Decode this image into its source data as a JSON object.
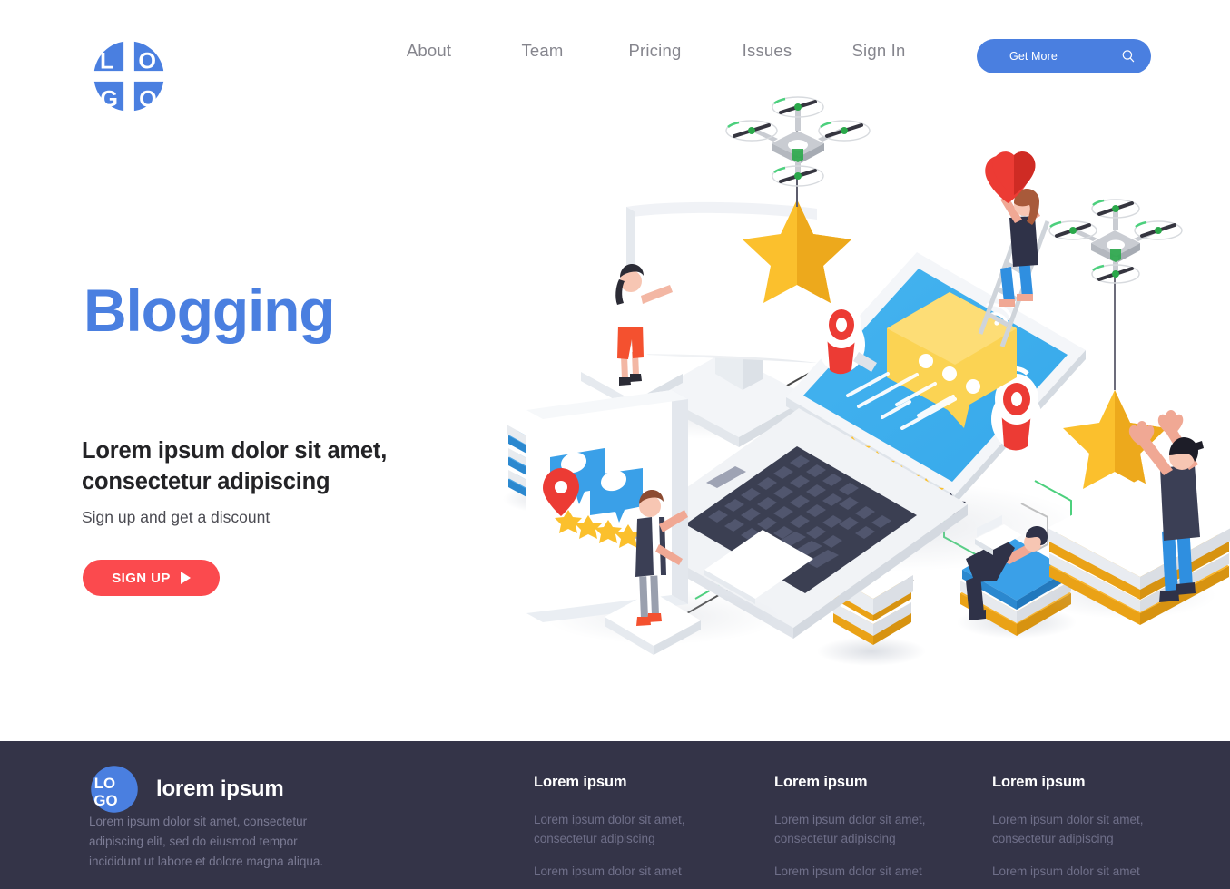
{
  "brand": {
    "logo_text_top": "LO",
    "logo_text_bottom": "GO",
    "accent_blue": "#4a7fe0",
    "accent_red": "#fb4a4e",
    "footer_bg": "#343448"
  },
  "header": {
    "nav": [
      {
        "label": "About"
      },
      {
        "label": "Team"
      },
      {
        "label": "Pricing"
      },
      {
        "label": "Issues"
      },
      {
        "label": "Sign In"
      }
    ],
    "cta": {
      "label": "Get More",
      "icon": "search-icon"
    }
  },
  "hero": {
    "title": "Blogging",
    "subtitle": "Lorem ipsum dolor sit amet, consectetur adipiscing",
    "description": "Sign up and get a discount",
    "button": {
      "label": "SIGN UP",
      "icon": "play-icon"
    }
  },
  "illustration": {
    "alt": "isometric blogging scene with laptop, monitors, drones, stars and people",
    "rating_stars_filled": 4,
    "rating_stars_total": 5
  },
  "footer": {
    "brand": "lorem ipsum",
    "about": "Lorem ipsum dolor sit amet, consectetur adipiscing elit, sed do eiusmod tempor incididunt ut labore et dolore magna aliqua.",
    "columns": [
      {
        "title": "Lorem ipsum",
        "links": [
          "Lorem ipsum dolor sit amet, consectetur adipiscing",
          "Lorem ipsum dolor sit amet"
        ]
      },
      {
        "title": "Lorem ipsum",
        "links": [
          "Lorem ipsum dolor sit amet, consectetur adipiscing",
          "Lorem ipsum dolor sit amet"
        ]
      },
      {
        "title": "Lorem ipsum",
        "links": [
          "Lorem ipsum dolor sit amet, consectetur adipiscing",
          "Lorem ipsum dolor sit amet"
        ]
      }
    ]
  }
}
